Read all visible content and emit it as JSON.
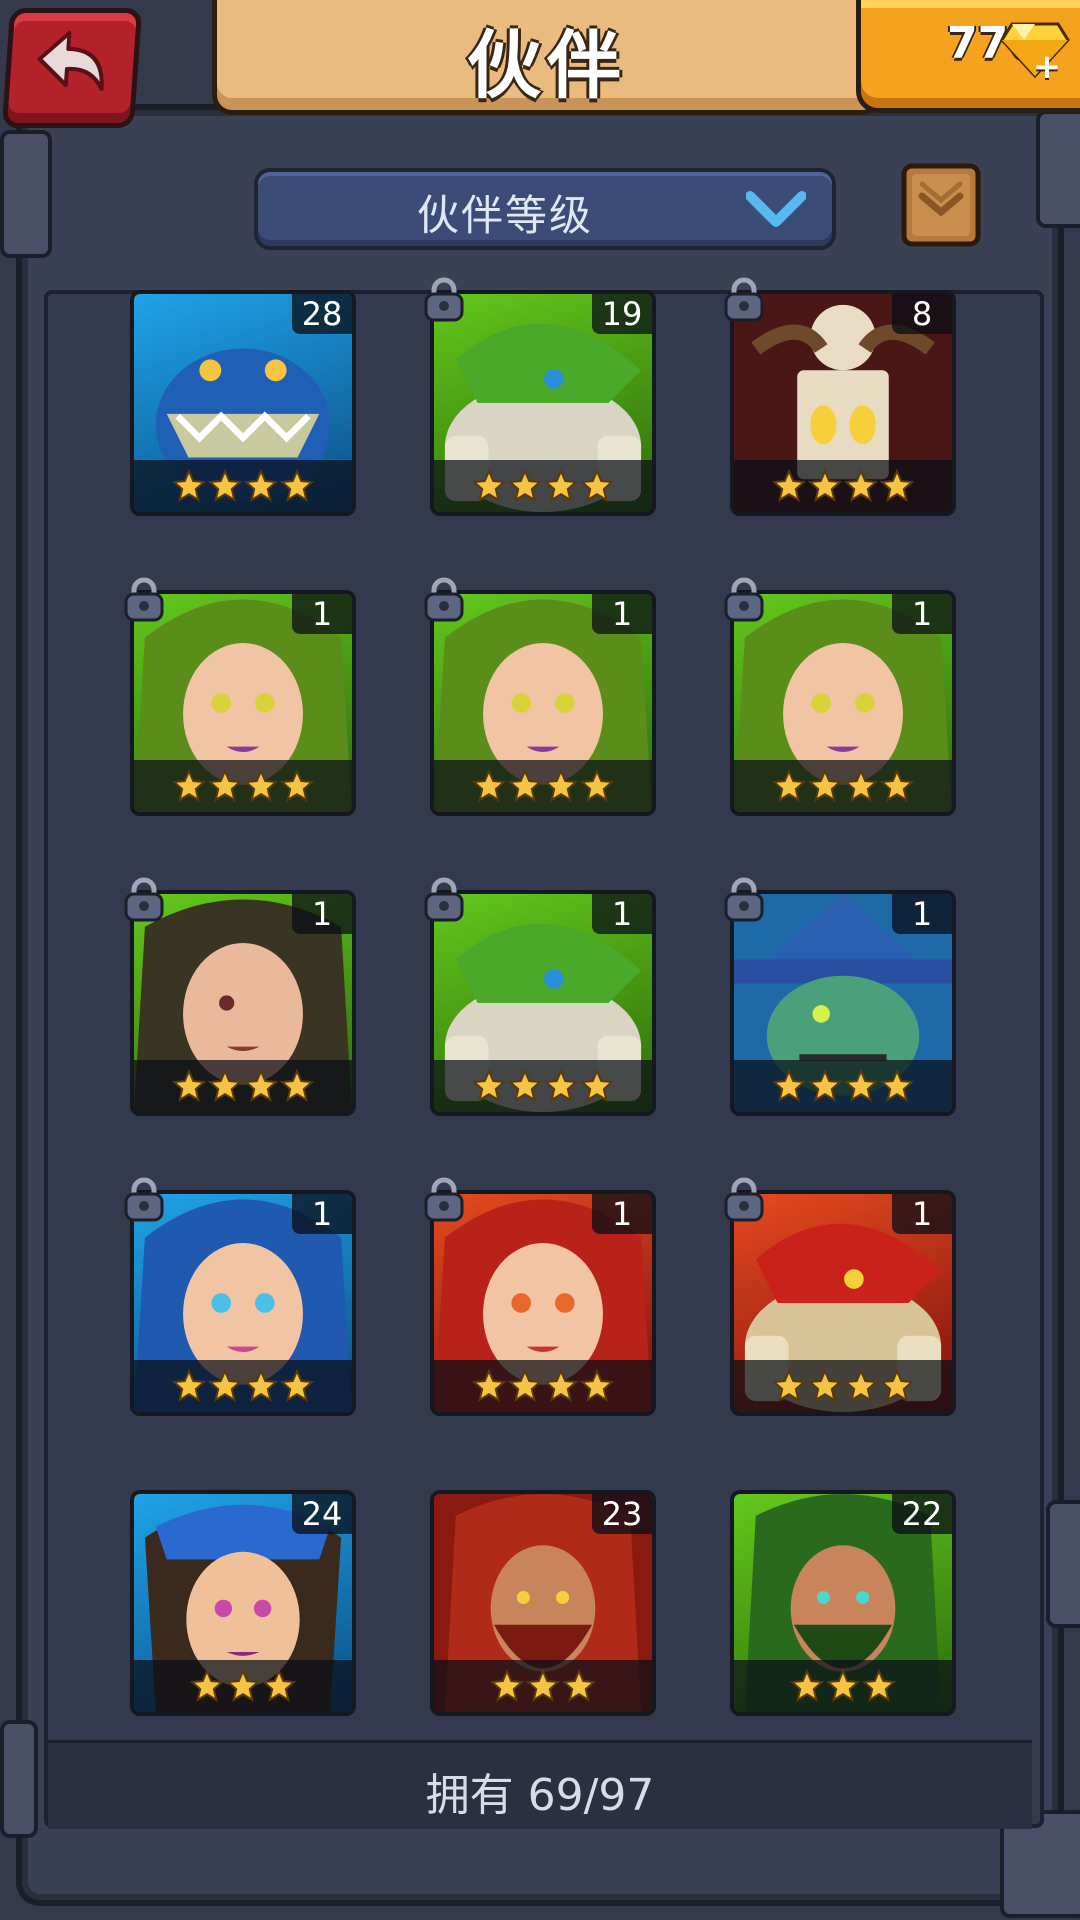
{
  "header": {
    "title": "伙伴",
    "gem_count": "776"
  },
  "filter": {
    "selected": "伙伴等级"
  },
  "companions": [
    {
      "level": "28",
      "stars": 4,
      "theme": "blue",
      "locked": false,
      "portrait": "blue-lizard"
    },
    {
      "level": "19",
      "stars": 4,
      "theme": "green",
      "locked": true,
      "portrait": "shark-brute"
    },
    {
      "level": "8",
      "stars": 4,
      "theme": "darkred",
      "locked": true,
      "portrait": "skull-shaman"
    },
    {
      "level": "1",
      "stars": 4,
      "theme": "green",
      "locked": true,
      "portrait": "green-haired-woman"
    },
    {
      "level": "1",
      "stars": 4,
      "theme": "green",
      "locked": true,
      "portrait": "green-haired-woman"
    },
    {
      "level": "1",
      "stars": 4,
      "theme": "green",
      "locked": true,
      "portrait": "green-haired-woman"
    },
    {
      "level": "1",
      "stars": 4,
      "theme": "green",
      "locked": true,
      "portrait": "dark-haired-woman"
    },
    {
      "level": "1",
      "stars": 4,
      "theme": "green",
      "locked": true,
      "portrait": "shark-brute"
    },
    {
      "level": "1",
      "stars": 4,
      "theme": "blue",
      "locked": true,
      "portrait": "scarecrow-witch"
    },
    {
      "level": "1",
      "stars": 4,
      "theme": "blue",
      "locked": true,
      "portrait": "blue-haired-woman"
    },
    {
      "level": "1",
      "stars": 4,
      "theme": "red",
      "locked": true,
      "portrait": "red-haired-woman"
    },
    {
      "level": "1",
      "stars": 4,
      "theme": "red",
      "locked": true,
      "portrait": "red-shark-brute"
    },
    {
      "level": "24",
      "stars": 3,
      "theme": "blue",
      "locked": false,
      "portrait": "blue-braided-woman"
    },
    {
      "level": "23",
      "stars": 3,
      "theme": "red",
      "locked": false,
      "portrait": "red-bearded-warrior"
    },
    {
      "level": "22",
      "stars": 3,
      "theme": "green",
      "locked": false,
      "portrait": "green-bearded-warrior"
    }
  ],
  "footer": {
    "owned_text": "拥有 69/97"
  },
  "colors": {
    "accent_gold": "#f5a21e",
    "star_gold": "#f6c445",
    "back_red": "#b3212b"
  }
}
